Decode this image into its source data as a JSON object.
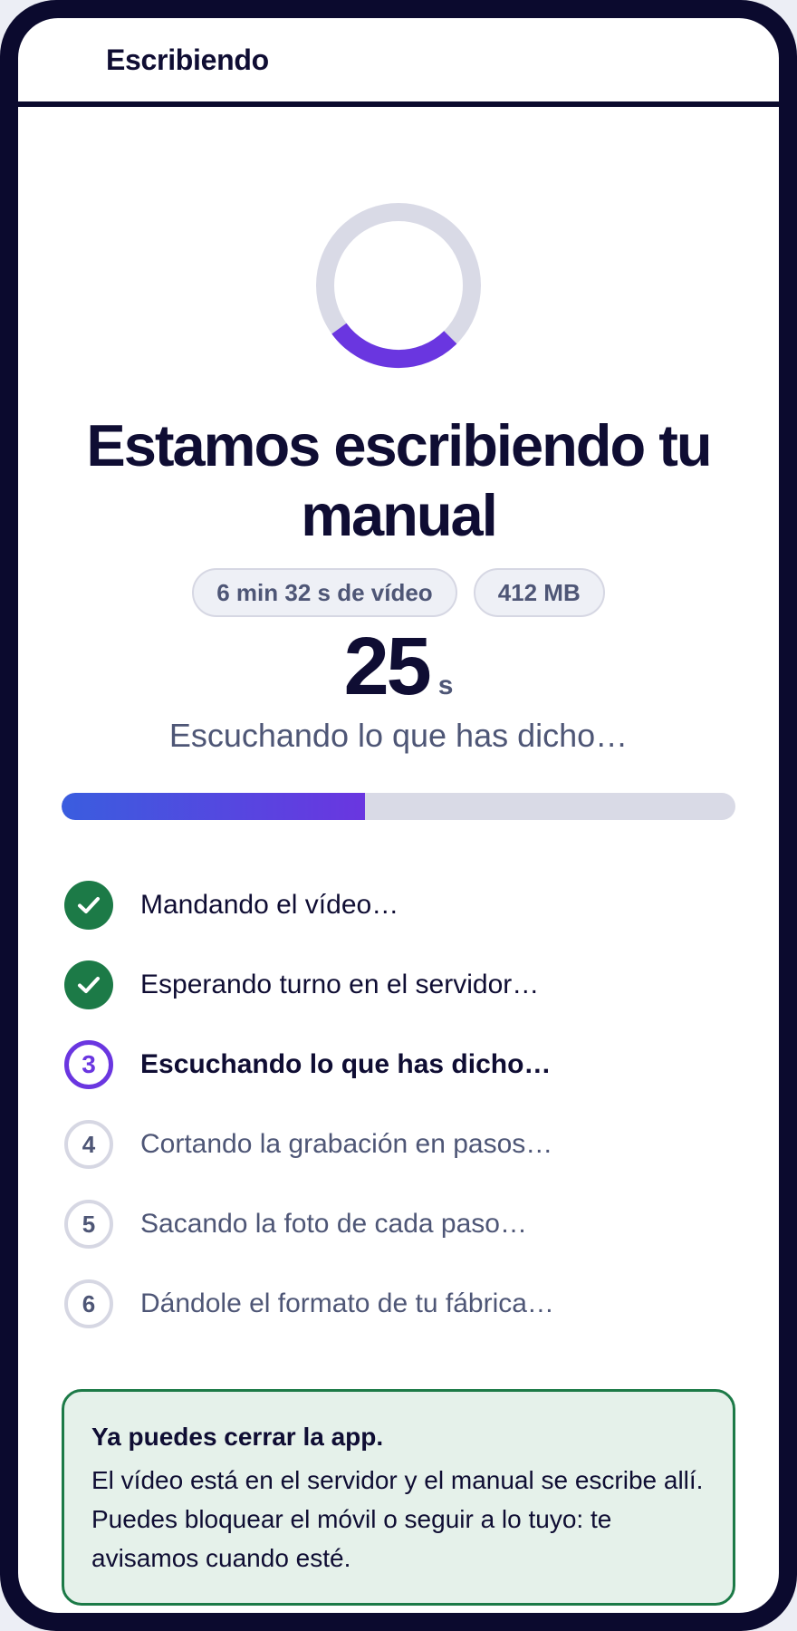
{
  "header": {
    "title": "Escribiendo"
  },
  "main": {
    "headline": "Estamos escribiendo tu manual",
    "chips": {
      "duration": "6 min 32 s de vídeo",
      "size": "412 MB"
    },
    "timer": {
      "value": "25",
      "unit": "s"
    },
    "status": "Escuchando lo que has dicho…",
    "progress_percent": 45,
    "colors": {
      "accent": "#6a36e0",
      "accent_start": "#3a5ddf",
      "success": "#1c7a47",
      "ink": "#0f0d33",
      "muted": "#4e5676"
    }
  },
  "steps": [
    {
      "state": "done",
      "number": "1",
      "icon": "check-icon",
      "label": "Mandando el vídeo…"
    },
    {
      "state": "done",
      "number": "2",
      "icon": "check-icon",
      "label": "Esperando turno en el servidor…"
    },
    {
      "state": "current",
      "number": "3",
      "label": "Escuchando lo que has dicho…"
    },
    {
      "state": "pending",
      "number": "4",
      "label": "Cortando la grabación en pasos…"
    },
    {
      "state": "pending",
      "number": "5",
      "label": "Sacando la foto de cada paso…"
    },
    {
      "state": "pending",
      "number": "6",
      "label": "Dándole el formato de tu fábrica…"
    }
  ],
  "notice": {
    "title": "Ya puedes cerrar la app.",
    "body": "El vídeo está en el servidor y el manual se escribe allí. Puedes bloquear el móvil o seguir a lo tuyo: te avisamos cuando esté."
  }
}
